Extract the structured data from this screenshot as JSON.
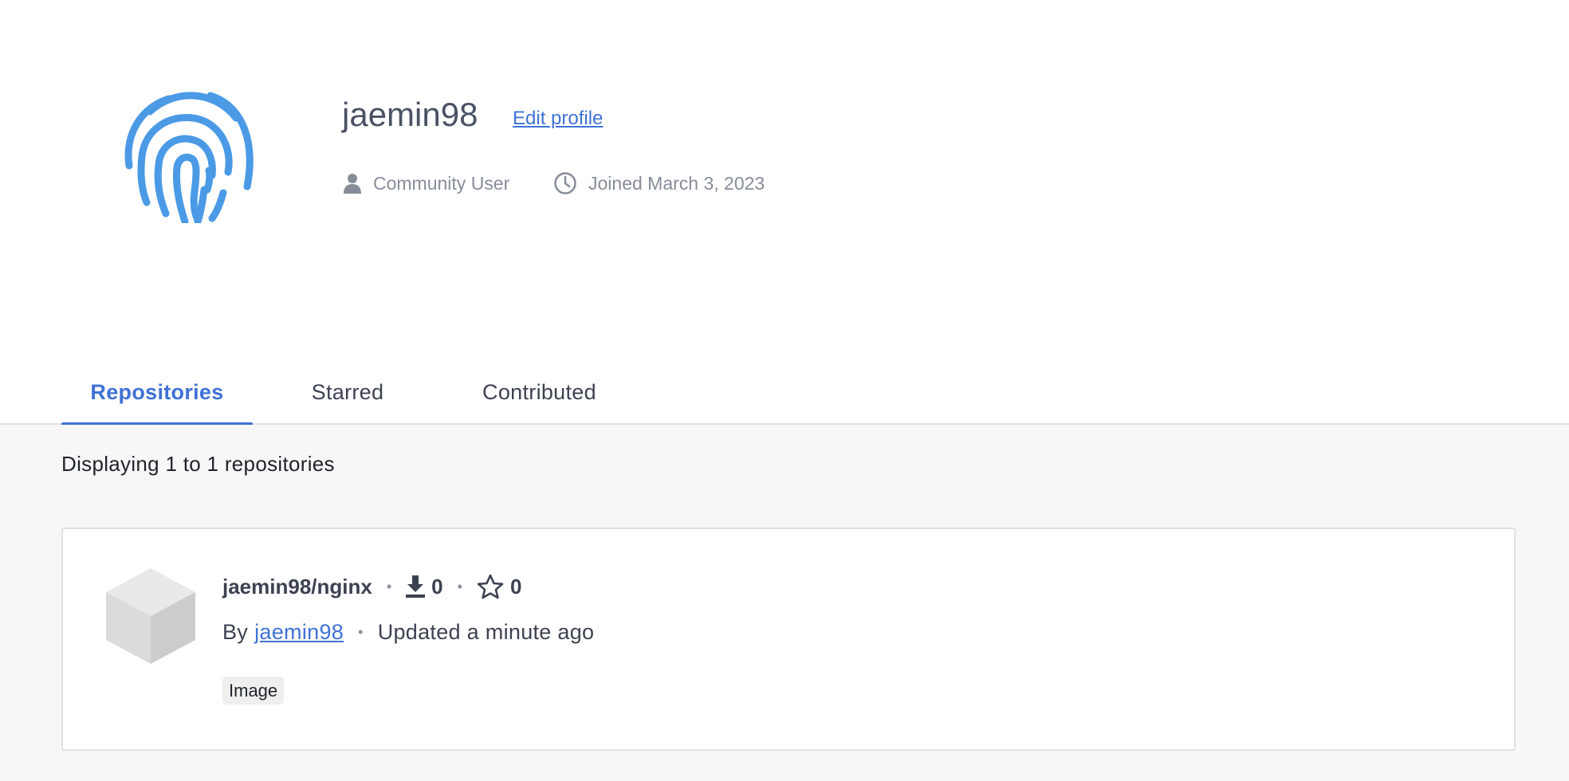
{
  "profile": {
    "username": "jaemin98",
    "edit_label": "Edit profile",
    "role": "Community User",
    "joined": "Joined March 3, 2023",
    "avatar_color": "#4a9ae6"
  },
  "tabs": [
    {
      "label": "Repositories",
      "active": true
    },
    {
      "label": "Starred",
      "active": false
    },
    {
      "label": "Contributed",
      "active": false
    }
  ],
  "listing": {
    "count_text": "Displaying 1 to 1 repositories"
  },
  "repository": {
    "name": "jaemin98/nginx",
    "pulls": "0",
    "stars": "0",
    "by_prefix": "By",
    "owner": "jaemin98",
    "updated": "Updated a minute ago",
    "badge": "Image",
    "separator": "•"
  },
  "colors": {
    "accent": "#3f72d6",
    "text": "#3d4251",
    "muted": "#868c98",
    "panel": "#f7f7f7"
  }
}
